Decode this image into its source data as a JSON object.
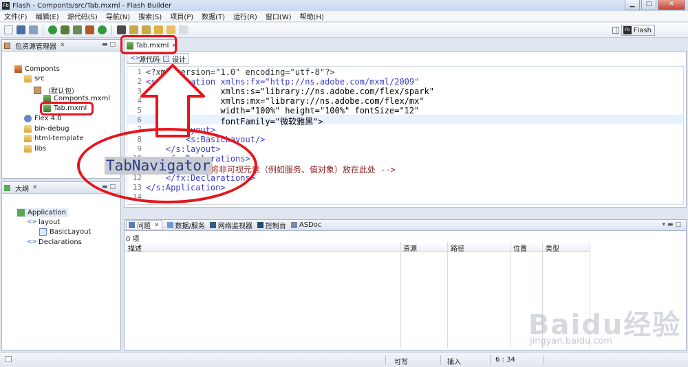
{
  "window": {
    "title": "Flash - Componts/src/Tab.mxml - Flash Builder",
    "icon_text": "Fb",
    "buttons": [
      "▁",
      "□",
      "✕"
    ]
  },
  "menu": [
    "文件(F)",
    "编辑(E)",
    "源代码(S)",
    "导航(N)",
    "搜索(S)",
    "项目(P)",
    "数据(T)",
    "运行(R)",
    "窗口(W)",
    "帮助(H)"
  ],
  "toolbar": {
    "perspective_label": "Flash",
    "perspective_icon_text": "Fb"
  },
  "package_explorer": {
    "title": "包资源管理器",
    "tree": [
      {
        "label": "Componts",
        "icon": "project-icon"
      },
      {
        "label": "src",
        "icon": "folder-icon"
      },
      {
        "label": "（默认包）",
        "icon": "package-icon"
      },
      {
        "label": "Componts.mxml",
        "icon": "mxml-file-icon"
      },
      {
        "label": "Tab.mxml",
        "icon": "mxml-file-icon"
      },
      {
        "label": "Flex 4.0",
        "icon": "library-icon"
      },
      {
        "label": "bin-debug",
        "icon": "folder-icon"
      },
      {
        "label": "html-template",
        "icon": "folder-icon"
      },
      {
        "label": "libs",
        "icon": "folder-icon"
      }
    ]
  },
  "outline": {
    "title": "大纲",
    "tree": [
      {
        "label": "Application",
        "icon": "application-icon"
      },
      {
        "label": "layout",
        "icon": "tag-icon"
      },
      {
        "label": "BasicLayout",
        "icon": "layout-icon"
      },
      {
        "label": "Declarations",
        "icon": "tag-icon"
      }
    ]
  },
  "editor": {
    "tab_label": "Tab.mxml",
    "source_tab": "源代码",
    "design_tab": "设计",
    "lines": [
      {
        "n": "1",
        "text": "<?xml version=\"1.0\" encoding=\"utf-8\"?>"
      },
      {
        "n": "2",
        "text": "<s:Application xmlns:fx=\"http://ns.adobe.com/mxml/2009\""
      },
      {
        "n": "3",
        "text": "               xmlns:s=\"library://ns.adobe.com/flex/spark\""
      },
      {
        "n": "4",
        "text": "               xmlns:mx=\"library://ns.adobe.com/flex/mx\""
      },
      {
        "n": "5",
        "text": "               width=\"100%\" height=\"100%\" fontSize=\"12\""
      },
      {
        "n": "6",
        "text": "               fontFamily=\"微软雅黑\">"
      },
      {
        "n": "7",
        "text": "    <s:layout>"
      },
      {
        "n": "8",
        "text": "        <s:BasicLayout/>"
      },
      {
        "n": "9",
        "text": "    </s:layout>"
      },
      {
        "n": "10",
        "text": "    <fx:Declarations>"
      },
      {
        "n": "11",
        "text": "        <!-- 将非可视元素（例如服务、值对象）放在此处 -->"
      },
      {
        "n": "12",
        "text": "    </fx:Declarations>"
      },
      {
        "n": "13",
        "text": "</s:Application>"
      },
      {
        "n": "14",
        "text": ""
      }
    ]
  },
  "bottom_panel": {
    "tabs": [
      "问题",
      "数据/服务",
      "网络监视器",
      "控制台",
      "ASDoc"
    ],
    "item_count": "0 项",
    "columns": [
      "描述",
      "资源",
      "路径",
      "位置",
      "类型"
    ]
  },
  "status_bar": {
    "writable": "可写",
    "insert_mode": "插入",
    "position": "6 : 34"
  },
  "annotation": {
    "label": "TabNavigator"
  },
  "watermark": {
    "logo": "Baidu经验",
    "url": "jingyan.baidu.com"
  },
  "colors": {
    "annotation_red": "#e8141b",
    "tag_blue": "#3a3ac8",
    "string_blue": "#2a00ff",
    "comment": "#8b1a1a"
  }
}
